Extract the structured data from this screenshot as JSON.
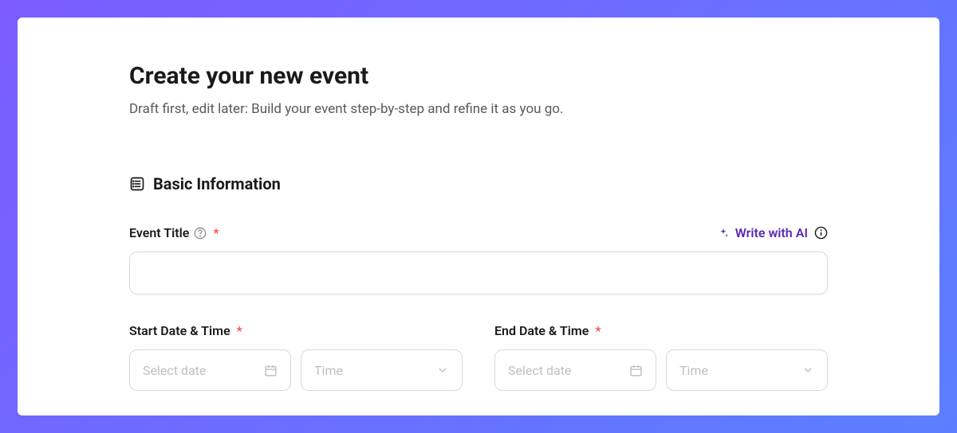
{
  "header": {
    "title": "Create your new event",
    "subtitle": "Draft first, edit later: Build your event step-by-step and refine it as you go."
  },
  "section": {
    "title": "Basic Information"
  },
  "fields": {
    "eventTitle": {
      "label": "Event Title",
      "required": "*",
      "aiButton": "Write with AI"
    },
    "startDateTime": {
      "label": "Start Date & Time",
      "required": "*",
      "datePlaceholder": "Select date",
      "timePlaceholder": "Time"
    },
    "endDateTime": {
      "label": "End Date & Time",
      "required": "*",
      "datePlaceholder": "Select date",
      "timePlaceholder": "Time"
    }
  }
}
